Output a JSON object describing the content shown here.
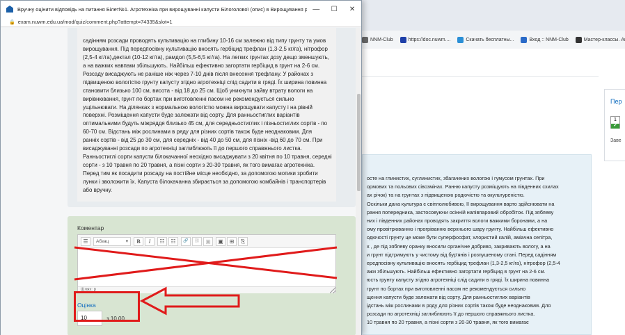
{
  "background_window": {
    "bookmarks": [
      {
        "label": "NNM-Club",
        "color": "#6a6a6a"
      },
      {
        "label": "https://doc.nuwm....",
        "color": "#1e3fa8"
      },
      {
        "label": "Скачать бесплатны...",
        "color": "#2a8fd6"
      },
      {
        "label": "Вход :: NNM-Club",
        "color": "#2a6ac8"
      },
      {
        "label": "Мастер-классы. Ак...",
        "color": "#333333"
      },
      {
        "label": "...",
        "color": "#888888"
      }
    ],
    "side_panel": {
      "title": "Пер",
      "box_number": "1",
      "check": "✔",
      "text": "Заве"
    },
    "question_text_lines": [
      "осте на глинистих, суглинистих, збагачених вологою і гумусом грунтах. При",
      "ормових та польових сівозмінах. Ранню капусту розміщують на південних схилах",
      "ах річок) та на грунтах з підвищеною родючістю та окультуреністю.",
      "Оскільки дана культура є світлолюбивою, її вирощування варто здійснювати на",
      "рання попередника, застосовуючи осінній напівпаровий обробіток. Під зяблеву",
      "них і південних районах проводять закриття вологи важкими боронами, а на",
      "ому провітрюванню і прогріванню верхнього шару грунту. Найбільш ефективно",
      "одючості грунту це може бути суперфосфат, хлористий калій, аміачна селітра,",
      "х , де під зяблеву оранку вносили органічне добриво, закривають вологу, а на",
      "и грунт підтримують у чистому від бур'янів і розпушеному стані. Перед садінням",
      "ередпосівну культивацію вносять гербіцид трефлан (1,3-2,5 кг/га), нітрофор (2,5-4",
      "ажи збільшують. Найбільш ефективно загортати гербіцид в грунт на 2-6 см.",
      "юсть грунту капусту згідно агротехнiці слід садити в грядi. Їх ширина повинна",
      "грунт по бортах при виготовленні пасом не рекомендується сильно",
      "щення капусти буде залежати від сорту. Для ранньостиглих варіантів",
      "ідстань між рослинами в ряду для різних сортів також буде неоднаковим. Для",
      "розсади по агротехніці заглиблюють її до першого справжнього листка.",
      "10 травня по 20 травня, а пізні сорти з 20-30 травня, як того вимагає"
    ]
  },
  "popup": {
    "title": "Вручну оцінити відповідь на питання Білет№1. Агротехніка при вирощуванні капусти Білоголової (опис) в Вирощування розсади кап...",
    "url": "exam.nuwm.edu.ua/mod/quiz/comment.php?attempt=74335&slot=1",
    "window_controls": {
      "minimize": "—",
      "maximize": "☐",
      "close": "✕"
    },
    "answer_lines": [
      "садінням розсади проводять культивацію на глибину 10-16 см залежно від типу грунту та умов",
      "вирощування. Під передпосівну культивацію вносять гербіцид трефлан (1,3-2,5 кг/га), нітрофор",
      "(2,5-4 кг/га),дектал (10-12 кг/га), рамдол (5,5-6,5 кг/га). На легких грунтах дозу дещо зменшують,",
      "а на важких навпаки збільшують. Найбільш ефективно загортати гербіцид в грунт на 2-6 см.",
      "Розсаду висаджують не раніше ніж через 7-10 днів після внесення трефлану.  У районах з",
      "підвищеною вологістю грунту капусту згідно агротехніці слід садити в грядi. Їх ширина повинна",
      "становити близько 100 см, висота - від 18 до 25 см. Щоб уникнути зайву втрату вологи на",
      "вирівнювання, грунт по бортах при виготовленні пасом не рекомендується сильно",
      "ущільнювати. На ділянках з нормальною вологістю можна вирощувати капусту і на рівній",
      "поверхні. Розміщення капусти буде залежати від сорту. Для ранньостиглих варіантів",
      "оптимальними будуть міжряддя близько 45 см, для середньостиглих і пізньостиглих сортів - по",
      "60-70 см. Відстань між рослинами в ряду для різних сортів також буде неоднаковим. Для",
      "ранніх сортів - від 25 до 30 см, для середніх - від 40 до 50 см, для пізніх -від 60 до 70 см. При",
      "висаджуванні розсади по агротехніці заглиблюють її до першого справжнього листка.",
      "Ранньостиглі сорти капусти білокачанної неохідно висаджувати з 20 квітня по 10 травня, середні",
      "сорти - з 10 травня по 20 травня, а пізні сорти з 20-30 травня, як того вимагає агротехніка.",
      "Перед тим як посадити розсаду на постійне місце необхідно, за допомогою мотики зробити",
      "лунки і зволожити їх. Капуста білокачанна збирається за допомогою комбайнів і транспортерів",
      "або вручну."
    ],
    "comment": {
      "label": "Коментар",
      "paragraph_format": "Абзац",
      "toolbar_buttons": [
        "☰",
        "B",
        "I",
        "☷",
        "☷",
        "🔗",
        "⛓",
        "▣",
        "▣",
        "⊞",
        "⎘"
      ],
      "status_path": "Шлях: p"
    },
    "grade": {
      "label": "Оцінка",
      "value": "10",
      "max_text": "з 10,00"
    }
  },
  "annotation": {
    "color": "#e01b1b"
  }
}
